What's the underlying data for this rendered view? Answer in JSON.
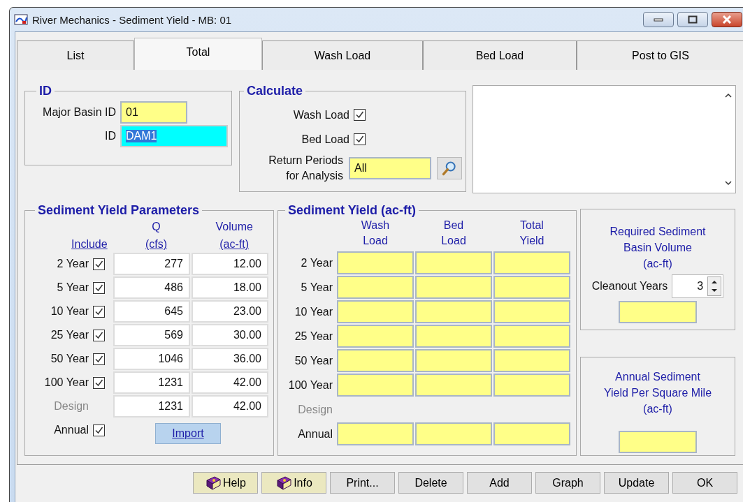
{
  "window": {
    "title": "River Mechanics - Sediment Yield - MB: 01"
  },
  "tabs": [
    {
      "label": "List",
      "selected": false
    },
    {
      "label": "Total",
      "selected": true
    },
    {
      "label": "Wash Load",
      "selected": false
    },
    {
      "label": "Bed Load",
      "selected": false
    },
    {
      "label": "Post to GIS",
      "selected": false
    }
  ],
  "id_group": {
    "title": "ID",
    "fields": [
      {
        "label": "Major Basin ID",
        "value": "01",
        "kind": "plain"
      },
      {
        "label": "ID",
        "value": "DAM1",
        "kind": "selected-text"
      }
    ]
  },
  "calculate": {
    "title": "Calculate",
    "options": [
      {
        "label": "Wash Load",
        "checked": true
      },
      {
        "label": "Bed Load",
        "checked": true
      }
    ],
    "return_periods": {
      "label_lines": [
        "Return Periods",
        "for Analysis"
      ],
      "value": "All"
    }
  },
  "parameters": {
    "title": "Sediment Yield Parameters",
    "headers": [
      {
        "link": "Include"
      },
      {
        "top": "Q",
        "link": "(cfs)"
      },
      {
        "top": "Volume",
        "link": "(ac-ft)"
      }
    ],
    "rows": [
      {
        "label": "2 Year",
        "kind": "checkbox",
        "checked": true,
        "disabled": false,
        "q": "277",
        "volume": "12.00"
      },
      {
        "label": "5 Year",
        "kind": "checkbox",
        "checked": true,
        "disabled": false,
        "q": "486",
        "volume": "18.00"
      },
      {
        "label": "10 Year",
        "kind": "checkbox",
        "checked": true,
        "disabled": false,
        "q": "645",
        "volume": "23.00"
      },
      {
        "label": "25 Year",
        "kind": "checkbox",
        "checked": true,
        "disabled": false,
        "q": "569",
        "volume": "30.00"
      },
      {
        "label": "50 Year",
        "kind": "checkbox",
        "checked": true,
        "disabled": false,
        "q": "1046",
        "volume": "36.00"
      },
      {
        "label": "100 Year",
        "kind": "checkbox",
        "checked": true,
        "disabled": false,
        "q": "1231",
        "volume": "42.00"
      },
      {
        "label": "Design",
        "kind": "plain",
        "disabled": true,
        "q": "1231",
        "volume": "42.00"
      }
    ],
    "annual": {
      "label": "Annual",
      "checked": true
    },
    "import_button": "Import"
  },
  "sediment_yield": {
    "title": "Sediment Yield (ac-ft)",
    "columns": [
      [
        "Wash",
        "Load"
      ],
      [
        "Bed",
        "Load"
      ],
      [
        "Total",
        "Yield"
      ]
    ],
    "rows": [
      {
        "label": "2 Year",
        "kind": "cells",
        "disabled": false
      },
      {
        "label": "5 Year",
        "kind": "cells",
        "disabled": false
      },
      {
        "label": "10 Year",
        "kind": "cells",
        "disabled": false
      },
      {
        "label": "25 Year",
        "kind": "cells",
        "disabled": false
      },
      {
        "label": "50 Year",
        "kind": "cells",
        "disabled": false
      },
      {
        "label": "100 Year",
        "kind": "cells",
        "disabled": false
      },
      {
        "label": "Design",
        "kind": "label",
        "disabled": true
      },
      {
        "label": "Annual",
        "kind": "cells",
        "disabled": false
      }
    ]
  },
  "basin_volume": {
    "title_lines": [
      "Required Sediment",
      "Basin Volume",
      "(ac-ft)"
    ],
    "cleanout_label": "Cleanout Years",
    "cleanout_value": "3"
  },
  "annual_yield": {
    "title_lines": [
      "Annual Sediment",
      "Yield Per Square Mile",
      "(ac-ft)"
    ]
  },
  "buttons": [
    {
      "label": "Help",
      "kind": "book"
    },
    {
      "label": "Info",
      "kind": "book"
    },
    {
      "label": "Print...",
      "kind": "plain"
    },
    {
      "label": "Delete",
      "kind": "plain"
    },
    {
      "label": "Add",
      "kind": "plain"
    },
    {
      "label": "Graph",
      "kind": "plain"
    },
    {
      "label": "Update",
      "kind": "plain"
    },
    {
      "label": "OK",
      "kind": "plain"
    }
  ]
}
